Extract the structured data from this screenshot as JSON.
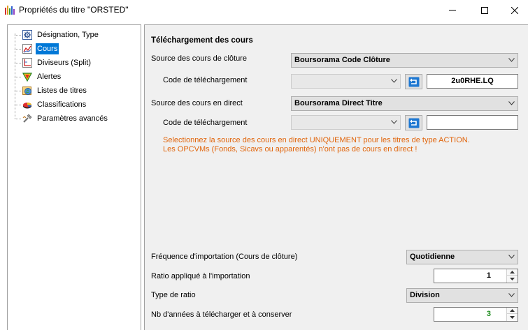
{
  "window": {
    "title": "Propriétés du titre \"ORSTED\"",
    "controls": [
      "minimize-icon",
      "maximize-icon",
      "close-icon"
    ]
  },
  "tree": {
    "items": [
      {
        "label": "Désignation, Type",
        "icon": "settings-gear-icon",
        "selected": false
      },
      {
        "label": "Cours",
        "icon": "line-chart-icon",
        "selected": true
      },
      {
        "label": "Diviseurs (Split)",
        "icon": "split-chart-icon",
        "selected": false
      },
      {
        "label": "Alertes",
        "icon": "alert-triangle-icon",
        "selected": false
      },
      {
        "label": "Listes de titres",
        "icon": "globe-list-icon",
        "selected": false
      },
      {
        "label": "Classifications",
        "icon": "pie-chart-icon",
        "selected": false
      },
      {
        "label": "Paramètres avancés",
        "icon": "wrench-tool-icon",
        "selected": false
      }
    ]
  },
  "main": {
    "section_title": "Téléchargement des cours",
    "close_source": {
      "label": "Source des cours de clôture",
      "value": "Boursorama Code Clôture",
      "code_label": "Code de téléchargement",
      "code_combo_value": "",
      "code_value": "2u0RHE.LQ"
    },
    "live_source": {
      "label": "Source des cours en direct",
      "value": "Boursorama Direct Titre",
      "code_label": "Code de téléchargement",
      "code_combo_value": "",
      "code_value": ""
    },
    "warning_line1": "Selectionnez la source des cours en direct UNIQUEMENT pour les titres de type ACTION.",
    "warning_line2": "Les OPCVMs (Fonds, Sicavs ou apparentés) n'ont pas de cours en direct !",
    "frequency": {
      "label": "Fréquence d'importation (Cours de clôture)",
      "value": "Quotidienne"
    },
    "ratio": {
      "label": "Ratio appliqué à l'importation",
      "value": "1"
    },
    "ratio_type": {
      "label": "Type de ratio",
      "value": "Division"
    },
    "years": {
      "label": "Nb d'années à télécharger et à conserver",
      "value": "3"
    }
  },
  "colors": {
    "selection": "#0078d7",
    "warning": "#e1640a",
    "years_value": "#1a8a1a",
    "panel_bg": "#f0f0f0",
    "refresh_icon": "#1e78d2"
  }
}
